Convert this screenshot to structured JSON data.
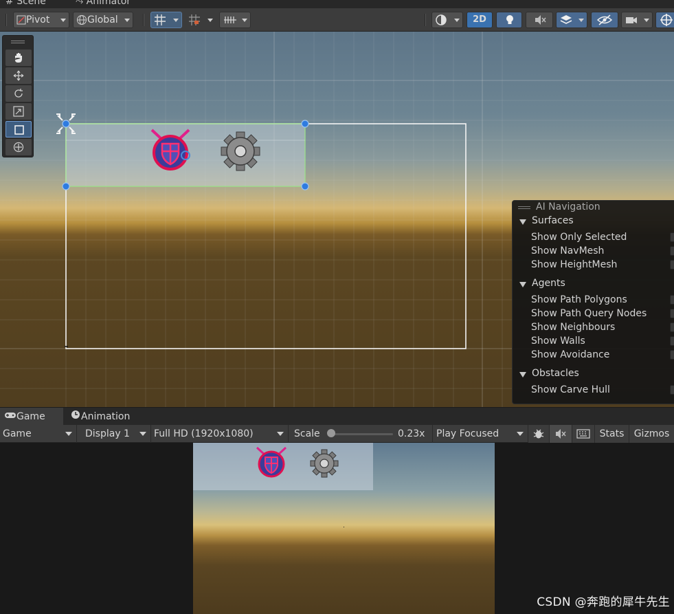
{
  "tabs": {
    "scene": "Scene",
    "animator": "Animator"
  },
  "scene_toolbar": {
    "pivot": "Pivot",
    "global": "Global",
    "mode_2d": "2D"
  },
  "tools": [
    "hand-tool",
    "move-tool",
    "rotate-tool",
    "scale-tool",
    "rect-tool",
    "transform-tool"
  ],
  "ai_navigation": {
    "title": "AI Navigation",
    "sections": [
      {
        "label": "Surfaces",
        "options": [
          "Show Only Selected",
          "Show NavMesh",
          "Show HeightMesh"
        ]
      },
      {
        "label": "Agents",
        "options": [
          "Show Path Polygons",
          "Show Path Query Nodes",
          "Show Neighbours",
          "Show Walls",
          "Show Avoidance"
        ]
      },
      {
        "label": "Obstacles",
        "options": [
          "Show Carve Hull"
        ]
      }
    ]
  },
  "game_tabs": {
    "game": "Game",
    "animation": "Animation"
  },
  "game_toolbar": {
    "view": "Game",
    "display": "Display 1",
    "resolution": "Full HD (1920x1080)",
    "scale_label": "Scale",
    "scale_value": "0.23x",
    "play_mode": "Play Focused",
    "stats": "Stats",
    "gizmos": "Gizmos"
  },
  "watermark": "CSDN @奔跑的犀牛先生",
  "colors": {
    "accent": "#3a72b0",
    "selection": "#6d9ad0",
    "handle": "#2e7be0"
  }
}
